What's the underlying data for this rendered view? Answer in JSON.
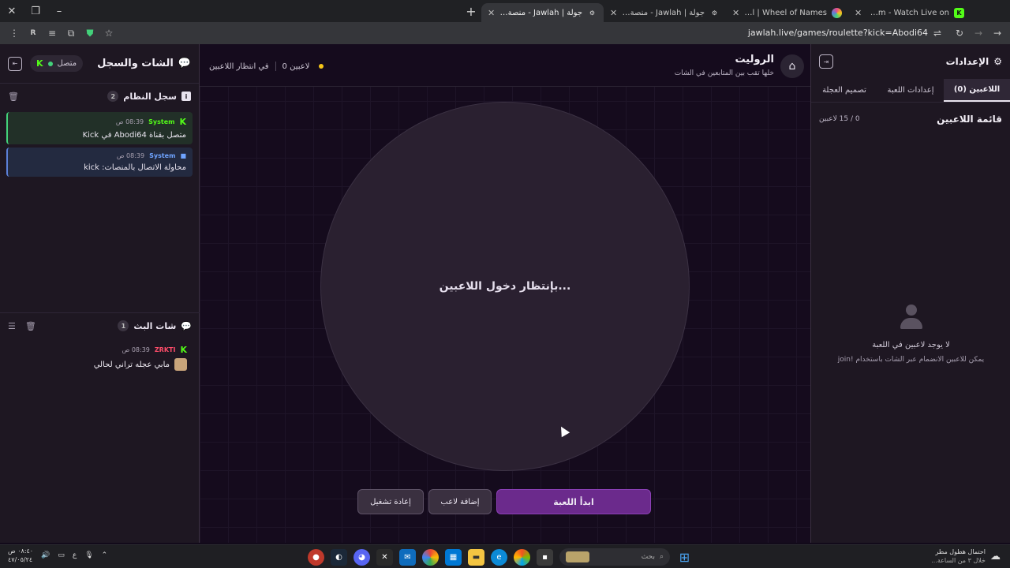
{
  "browser": {
    "tabs": [
      {
        "title": "iMartinx Stream - Watch Live on",
        "icon": "kick-icon",
        "icon_color": "#53fc18"
      },
      {
        "title": "Wheel of Names | اسم العشوائي",
        "icon": "wheel-icon",
        "icon_color": "#e94b8a"
      },
      {
        "title": "جولة | Jawlah - منصة الألعاب الت",
        "icon": "jawlah-icon",
        "icon_color": "#d8d8d8"
      },
      {
        "title": "جولة | Jawlah - منصة الألعاب الت",
        "icon": "jawlah-icon",
        "icon_color": "#d8d8d8"
      }
    ],
    "url": "jawlah.live/games/roulette?kick=Abodi64"
  },
  "chat_panel": {
    "title": "الشات والسجل",
    "status": "متصل",
    "system_log": {
      "title": "سجل النظام",
      "count": "2",
      "entries": [
        {
          "user": "System",
          "time": "08:39 ص",
          "text": "متصل بقناة Abodi64 في Kick",
          "type": "kick"
        },
        {
          "user": "System",
          "time": "08:39 ص",
          "text": "محاولة الاتصال بالمنصات: kick",
          "type": "sys"
        }
      ]
    },
    "stream_chat": {
      "title": "شات البث",
      "count": "1",
      "messages": [
        {
          "user": "ZRKTI",
          "time": "08:39 ص",
          "text": "مابي عجله تراني لحالي"
        }
      ]
    }
  },
  "game": {
    "title": "الروليت",
    "subtitle": "خلها تقب بين المتابعين في الشات",
    "players_count": "0 لاعبين",
    "state": "في انتظار اللاعبين",
    "wheel_text": "بإنتظار دخول اللاعبين...",
    "buttons": {
      "start": "ابدأ اللعبة",
      "add_player": "إضافة لاعب",
      "restart": "إعادة تشغيل"
    }
  },
  "settings": {
    "title": "الإعدادات",
    "tabs": [
      "اللاعبين (0)",
      "إعدادات اللعبة",
      "تصميم العجلة"
    ],
    "players_list_title": "قائمة اللاعبين",
    "players_limit": "0 / 15 لاعبين",
    "empty_title": "لا يوجد لاعبين في اللعبة",
    "empty_sub": "يمكن للاعبين الانضمام عبر الشات باستخدام !join"
  },
  "taskbar": {
    "search": "بحث",
    "time": "٠٨:٤٠ ص",
    "date": "٤٧/٠٥/٢٤",
    "lang": "ع",
    "weather_title": "احتمال هطول مطر",
    "weather_sub": "خلال ٣ من الساعة..."
  },
  "colors": {
    "accent": "#6b2a8c",
    "kick": "#53fc18",
    "status_online": "#43d17a",
    "waiting": "#f5c518"
  }
}
